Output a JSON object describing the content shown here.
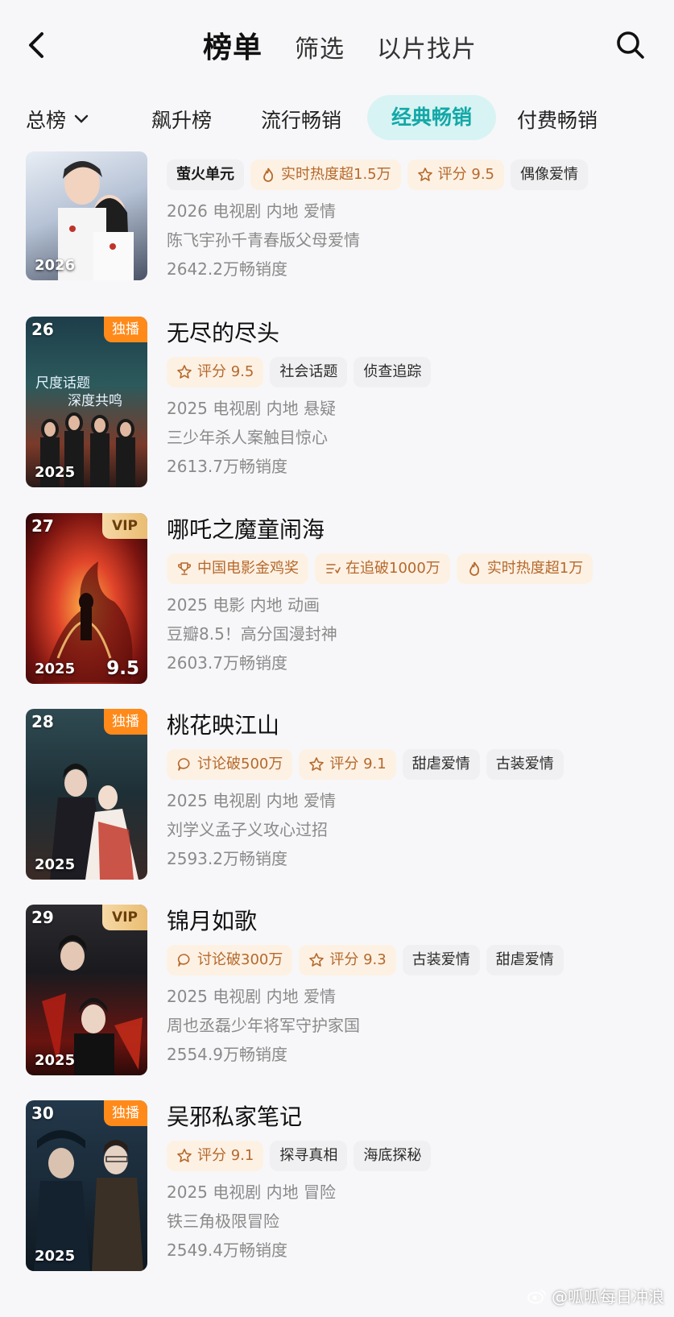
{
  "header": {
    "tabs": [
      {
        "label": "榜单",
        "active": true
      },
      {
        "label": "筛选",
        "active": false
      },
      {
        "label": "以片找片",
        "active": false
      }
    ]
  },
  "categories": {
    "total_label": "总榜",
    "tabs": [
      {
        "label": "飙升榜",
        "active": false
      },
      {
        "label": "流行畅销",
        "active": false
      },
      {
        "label": "经典畅销",
        "active": true
      },
      {
        "label": "付费畅销",
        "active": false
      }
    ]
  },
  "colors": {
    "accent": "#13a8a8",
    "accent_bg": "#d8f3f3",
    "exclusive_badge": "#ff8a1a",
    "vip_badge": "#e9bd72",
    "orange_tag_bg": "#fdf1e4",
    "orange_tag_text": "#b5692b"
  },
  "items": [
    {
      "rank": "",
      "badge": "",
      "year": "2026",
      "poster_score": "",
      "title": "",
      "tags": [
        {
          "text": "萤火单元",
          "style": "brand",
          "icon": ""
        },
        {
          "text": "实时热度超1.5万",
          "style": "orange",
          "icon": "flame-icon"
        },
        {
          "text": "评分 9.5",
          "style": "orange",
          "icon": "star-icon"
        },
        {
          "text": "偶像爱情",
          "style": "gray",
          "icon": ""
        }
      ],
      "meta": "2026 电视剧 内地 爱情",
      "desc": "陈飞宇孙千青春版父母爱情",
      "sales": "2642.2万畅销度"
    },
    {
      "rank": "26",
      "badge": "独播",
      "year": "2025",
      "poster_score": "",
      "title": "无尽的尽头",
      "tags": [
        {
          "text": "评分 9.5",
          "style": "orange",
          "icon": "star-icon"
        },
        {
          "text": "社会话题",
          "style": "gray",
          "icon": ""
        },
        {
          "text": "侦查追踪",
          "style": "gray",
          "icon": ""
        }
      ],
      "meta": "2025 电视剧 内地 悬疑",
      "desc": "三少年杀人案触目惊心",
      "sales": "2613.7万畅销度"
    },
    {
      "rank": "27",
      "badge": "VIP",
      "year": "2025",
      "poster_score": "9.5",
      "title": "哪吒之魔童闹海",
      "tags": [
        {
          "text": "中国电影金鸡奖",
          "style": "orange",
          "icon": "trophy-icon"
        },
        {
          "text": "在追破1000万",
          "style": "orange",
          "icon": "list-icon"
        },
        {
          "text": "实时热度超1万",
          "style": "orange",
          "icon": "flame-icon"
        }
      ],
      "meta": "2025 电影 内地 动画",
      "desc": "豆瓣8.5！高分国漫封神",
      "sales": "2603.7万畅销度"
    },
    {
      "rank": "28",
      "badge": "独播",
      "year": "2025",
      "poster_score": "",
      "title": "桃花映江山",
      "tags": [
        {
          "text": "讨论破500万",
          "style": "orange",
          "icon": "comment-icon"
        },
        {
          "text": "评分 9.1",
          "style": "orange",
          "icon": "star-icon"
        },
        {
          "text": "甜虐爱情",
          "style": "gray",
          "icon": ""
        },
        {
          "text": "古装爱情",
          "style": "gray",
          "icon": ""
        }
      ],
      "meta": "2025 电视剧 内地 爱情",
      "desc": "刘学义孟子义攻心过招",
      "sales": "2593.2万畅销度"
    },
    {
      "rank": "29",
      "badge": "VIP",
      "year": "2025",
      "poster_score": "",
      "title": "锦月如歌",
      "tags": [
        {
          "text": "讨论破300万",
          "style": "orange",
          "icon": "comment-icon"
        },
        {
          "text": "评分 9.3",
          "style": "orange",
          "icon": "star-icon"
        },
        {
          "text": "古装爱情",
          "style": "gray",
          "icon": ""
        },
        {
          "text": "甜虐爱情",
          "style": "gray",
          "icon": ""
        }
      ],
      "meta": "2025 电视剧 内地 爱情",
      "desc": "周也丞磊少年将军守护家国",
      "sales": "2554.9万畅销度"
    },
    {
      "rank": "30",
      "badge": "独播",
      "year": "2025",
      "poster_score": "",
      "title": "吴邪私家笔记",
      "tags": [
        {
          "text": "评分 9.1",
          "style": "orange",
          "icon": "star-icon"
        },
        {
          "text": "探寻真相",
          "style": "gray",
          "icon": ""
        },
        {
          "text": "海底探秘",
          "style": "gray",
          "icon": ""
        }
      ],
      "meta": "2025 电视剧 内地 冒险",
      "desc": "铁三角极限冒险",
      "sales": "2549.4万畅销度"
    }
  ],
  "watermark": "@呱呱每日冲浪"
}
